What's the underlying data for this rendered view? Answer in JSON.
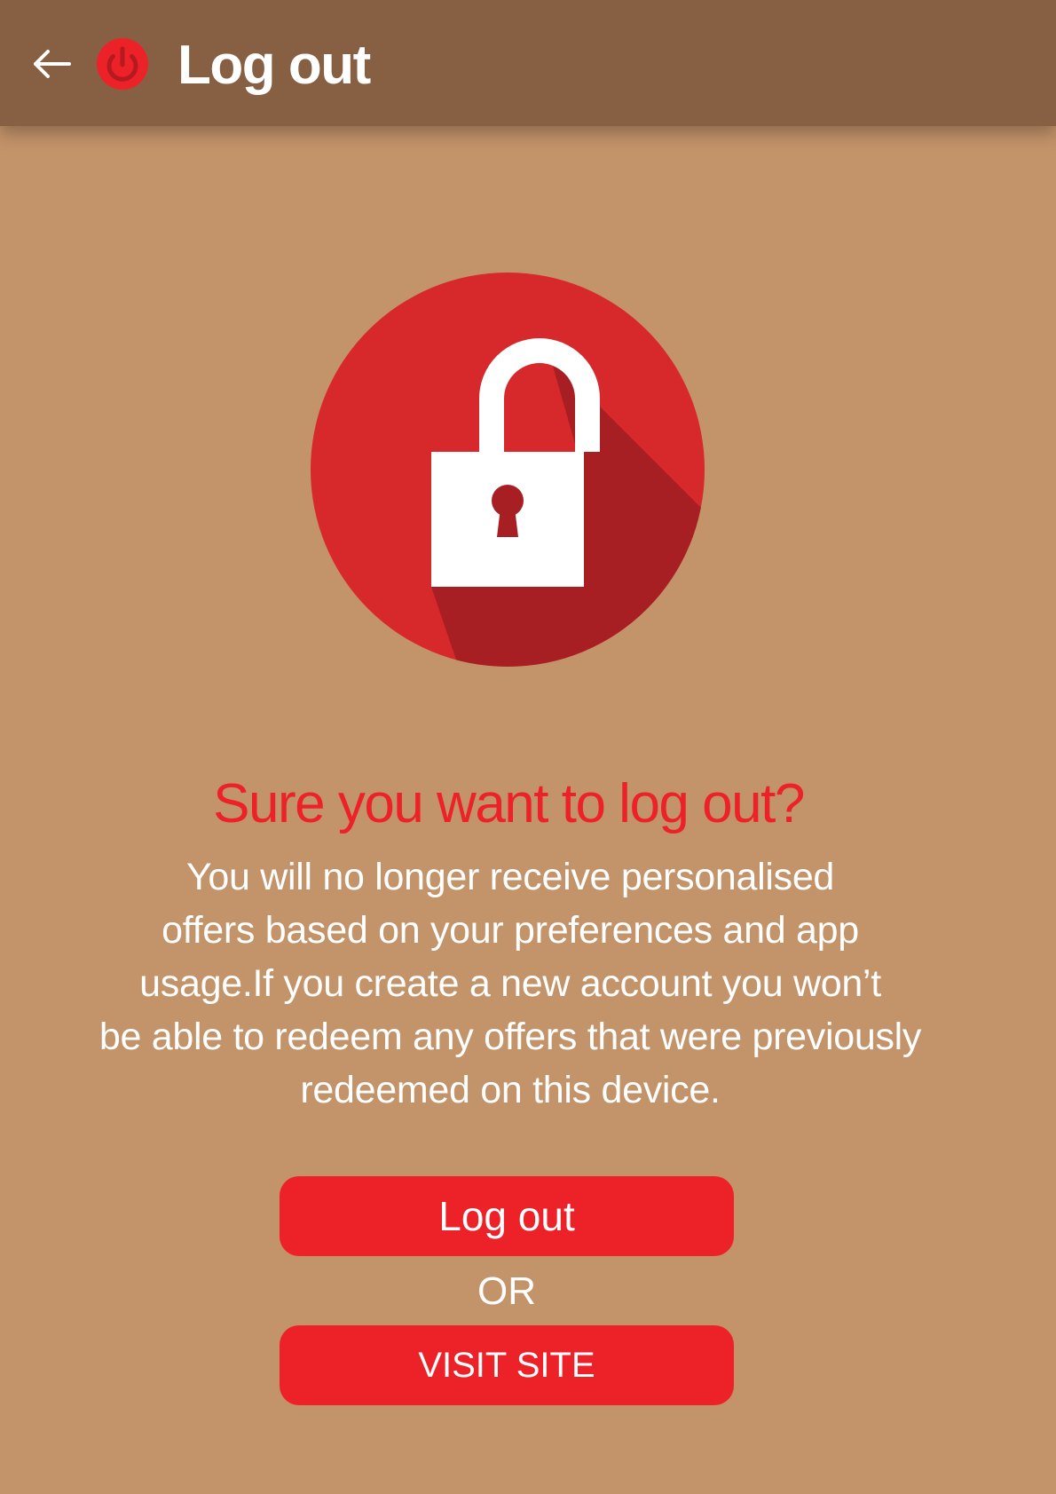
{
  "app_bar": {
    "back_icon": "arrow-left-icon",
    "power_icon": "power-icon",
    "title": "Log out",
    "accent_color": "#ed2228",
    "background_color": "#875f43"
  },
  "illustration": {
    "icon": "padlock-icon",
    "circle_color": "#d7282c",
    "shadow_color": "#a81f23"
  },
  "dialog": {
    "heading": "Sure you want to log out?",
    "message_lines": [
      "You will no longer receive personalised",
      "offers based on your preferences and app",
      "usage.If you create a new account you won’t",
      "be able to redeem any offers that were previously",
      "redeemed on this device."
    ]
  },
  "actions": {
    "logout_label": "Log out",
    "or_label": "OR",
    "visit_site_label": "VISIT SITE",
    "button_color": "#ed2228"
  },
  "background_color": "#c3936a"
}
